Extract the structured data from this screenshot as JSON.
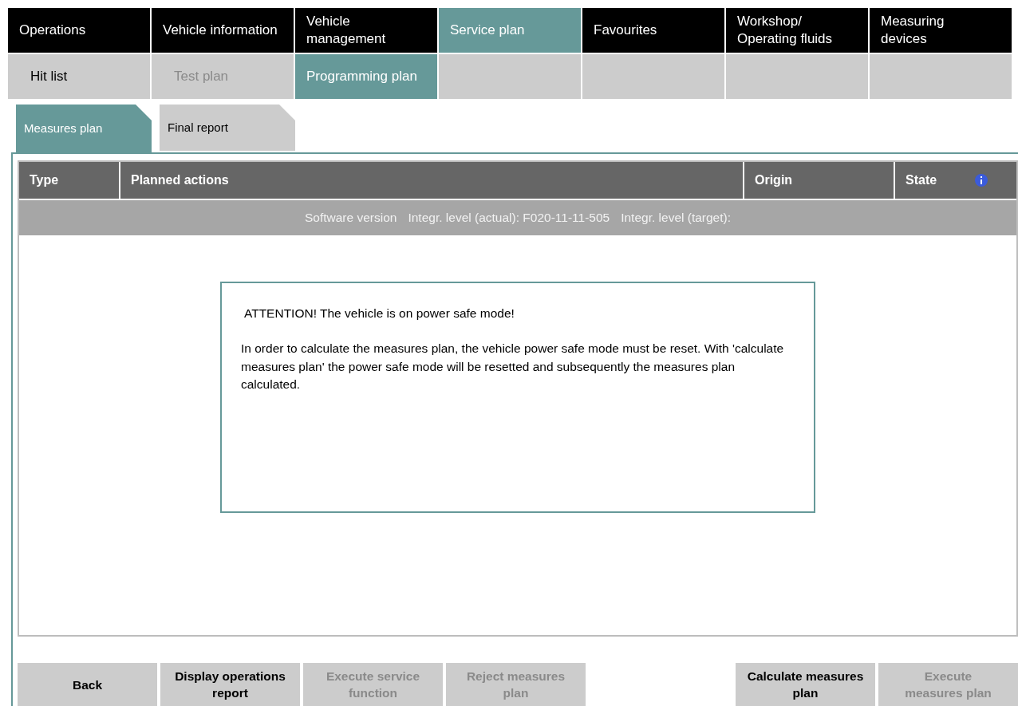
{
  "main_tabs": [
    {
      "label": "Operations",
      "selected": false
    },
    {
      "label": "Vehicle information",
      "selected": false
    },
    {
      "label": "Vehicle management",
      "selected": false
    },
    {
      "label": "Service plan",
      "selected": true
    },
    {
      "label": "Favourites",
      "selected": false
    },
    {
      "label": "Workshop/ Operating fluids",
      "selected": false
    },
    {
      "label": "Measuring devices",
      "selected": false
    }
  ],
  "sub_tabs": [
    {
      "label": "Hit list",
      "selected": false,
      "disabled": false
    },
    {
      "label": "Test plan",
      "selected": false,
      "disabled": true
    },
    {
      "label": "Programming plan",
      "selected": true,
      "disabled": false
    }
  ],
  "view_tabs": [
    {
      "label": "Measures plan",
      "selected": true
    },
    {
      "label": "Final report",
      "selected": false
    }
  ],
  "table": {
    "columns": [
      "Type",
      "Planned actions",
      "Origin",
      "State"
    ],
    "info_row": [
      "Software version",
      "Integr. level (actual): F020-11-11-505",
      "Integr. level (target):"
    ]
  },
  "dialog": {
    "title": "ATTENTION! The vehicle is on power safe mode!",
    "message": "In order to calculate the measures plan, the vehicle power safe mode must be reset. With 'calculate measures plan' the power safe mode will be resetted and subsequently the measures plan calculated."
  },
  "buttons": [
    {
      "label": "Back",
      "disabled": false
    },
    {
      "label": "Display operations report",
      "disabled": false
    },
    {
      "label": "Execute service function",
      "disabled": true
    },
    {
      "label": "Reject measures plan",
      "disabled": true
    },
    {
      "label": "Calculate measures plan",
      "disabled": false
    },
    {
      "label": "Execute measures plan",
      "disabled": true
    }
  ]
}
